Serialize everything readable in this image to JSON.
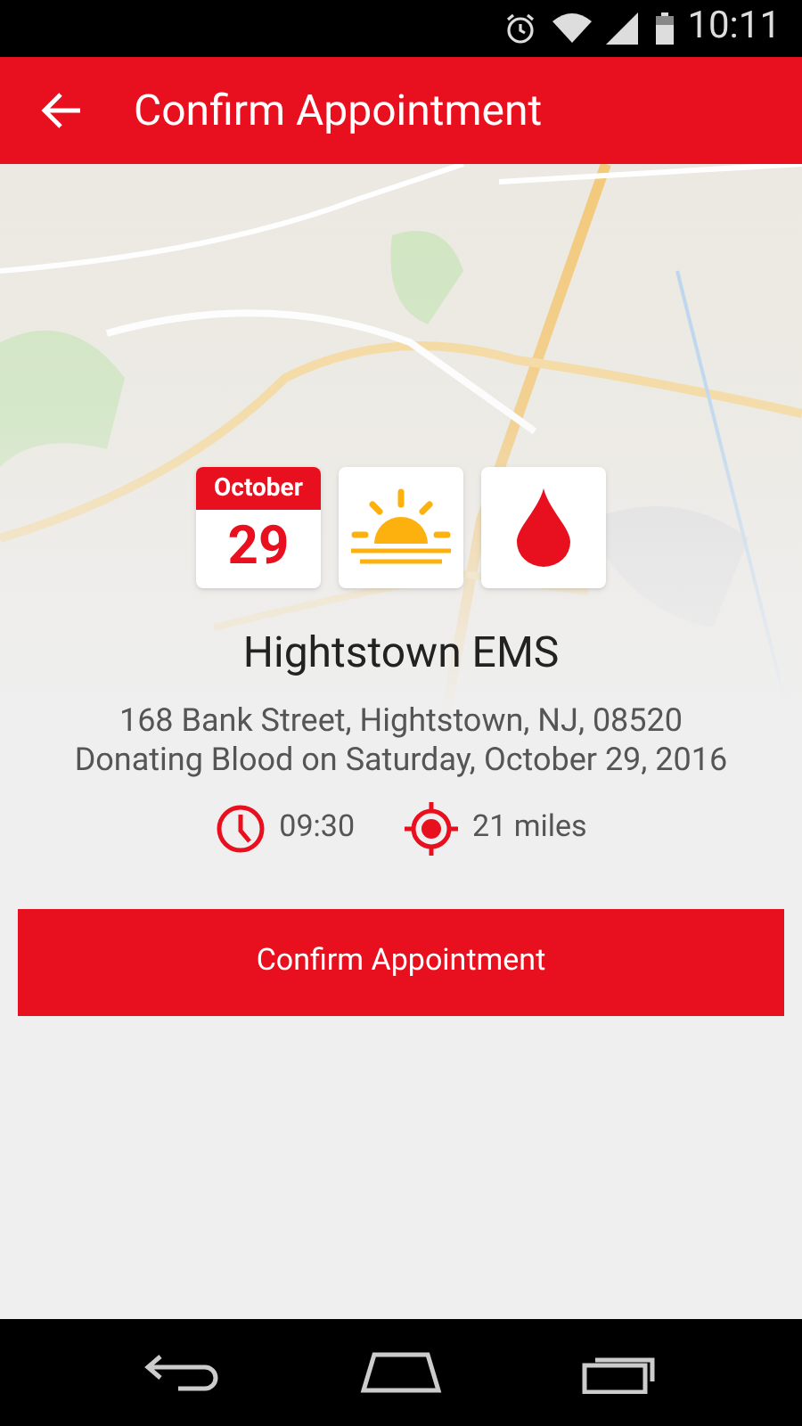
{
  "status_bar": {
    "time": "10:11"
  },
  "app_bar": {
    "title": "Confirm Appointment"
  },
  "appointment": {
    "month": "October",
    "day": "29",
    "location": "Hightstown EMS",
    "address": "168 Bank Street, Hightstown, NJ, 08520",
    "description": "Donating Blood on Saturday, October 29, 2016",
    "time": "09:30",
    "distance": "21 miles"
  },
  "button": {
    "label": "Confirm Appointment"
  }
}
